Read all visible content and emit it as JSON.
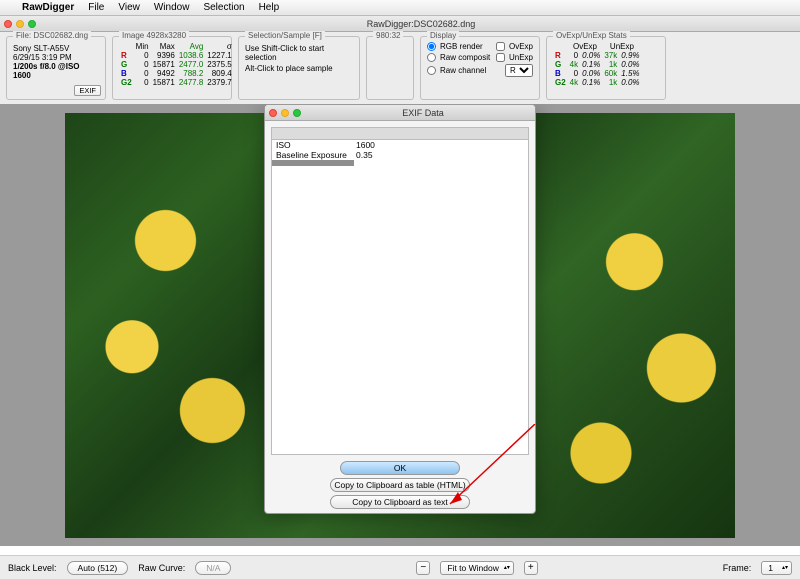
{
  "menubar": {
    "app": "RawDigger",
    "items": [
      "File",
      "View",
      "Window",
      "Selection",
      "Help"
    ]
  },
  "window": {
    "title": "RawDigger:DSC02682.dng"
  },
  "filePanel": {
    "title": "File: DSC02682.dng",
    "camera": "Sony SLT-A55V",
    "date": "6/29/15 3:19 PM",
    "exposure": "1/200s f/8.0 @ISO 1600",
    "exifBtn": "EXIF"
  },
  "imagePanel": {
    "title": "Image 4928x3280",
    "headers": [
      "",
      "Min",
      "Max",
      "Avg",
      "σ"
    ],
    "rows": [
      {
        "ch": "R",
        "min": "0",
        "max": "9396",
        "avg": "1038.6",
        "sig": "1227.1"
      },
      {
        "ch": "G",
        "min": "0",
        "max": "15871",
        "avg": "2477.0",
        "sig": "2375.5"
      },
      {
        "ch": "B",
        "min": "0",
        "max": "9492",
        "avg": "788.2",
        "sig": "809.4"
      },
      {
        "ch": "G2",
        "min": "0",
        "max": "15871",
        "avg": "2477.8",
        "sig": "2379.7"
      }
    ]
  },
  "selectionPanel": {
    "title": "Selection/Sample [F]",
    "line1": "Use Shift-Click to start selection",
    "line2": "Alt-Click to place sample"
  },
  "ratioPanel": {
    "title": "980:32"
  },
  "displayPanel": {
    "title": "Display",
    "rgb": "RGB render",
    "ov": "OvExp",
    "comp": "Raw composit",
    "un": "UnExp",
    "chan": "Raw channel",
    "chSel": "R"
  },
  "statsPanel": {
    "title": "OvExp/UnExp Stats",
    "headers": [
      "",
      "OvExp",
      "",
      "UnExp",
      ""
    ],
    "rows": [
      {
        "ch": "R",
        "ov": "0",
        "ovp": "0.0%",
        "un": "37k",
        "unp": "0.9%"
      },
      {
        "ch": "G",
        "ov": "4k",
        "ovp": "0.1%",
        "un": "1k",
        "unp": "0.0%"
      },
      {
        "ch": "B",
        "ov": "0",
        "ovp": "0.0%",
        "un": "60k",
        "unp": "1.5%"
      },
      {
        "ch": "G2",
        "ov": "4k",
        "ovp": "0.1%",
        "un": "1k",
        "unp": "0.0%"
      }
    ]
  },
  "dialog": {
    "title": "EXIF Data",
    "rows": [
      {
        "k": "ISO",
        "v": "1600"
      },
      {
        "k": "Baseline Exposure",
        "v": "0.35"
      }
    ],
    "ok": "OK",
    "copyHtml": "Copy to Clipboard as table (HTML)",
    "copyText": "Copy to Clipboard as text"
  },
  "footer": {
    "blackLabel": "Black Level:",
    "blackBtn": "Auto (512)",
    "curveLabel": "Raw Curve:",
    "curveVal": "N/A",
    "fit": "Fit to Window",
    "frameLabel": "Frame:",
    "frameVal": "1"
  }
}
